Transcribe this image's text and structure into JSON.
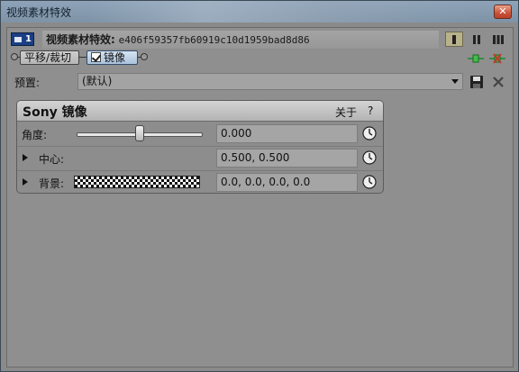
{
  "window": {
    "title": "视频素材特效",
    "close_glyph": "✕"
  },
  "header": {
    "chain_number": "1",
    "clip_label": "视频素材特效:",
    "clip_id": "e406f59357fb60919c10d1959bad8d86"
  },
  "chain": {
    "items": [
      {
        "label": "平移/裁切",
        "selected": false
      },
      {
        "label": "镜像",
        "selected": true,
        "checked": true
      }
    ]
  },
  "preset": {
    "label": "预置:",
    "value": "(默认)"
  },
  "effect": {
    "title": "Sony 镜像",
    "about_label": "关于",
    "help_label": "?",
    "params": [
      {
        "label": "角度:",
        "value": "0.000",
        "slider_fraction": 0.5
      },
      {
        "label": "中心:",
        "value": "0.500, 0.500",
        "expandable": true
      },
      {
        "label": "背景:",
        "value": "0.0, 0.0, 0.0, 0.0",
        "expandable": true
      }
    ]
  },
  "colors": {
    "title_bar": "#8ea3b8",
    "panel_bg": "#8d8d8d",
    "chain_number_bg": "#1b3f84",
    "selected_tab": "#a9c2dc",
    "close_button": "#c8533a",
    "add_icon": "#1d8a2a",
    "remove_icon": "#c0392b"
  }
}
